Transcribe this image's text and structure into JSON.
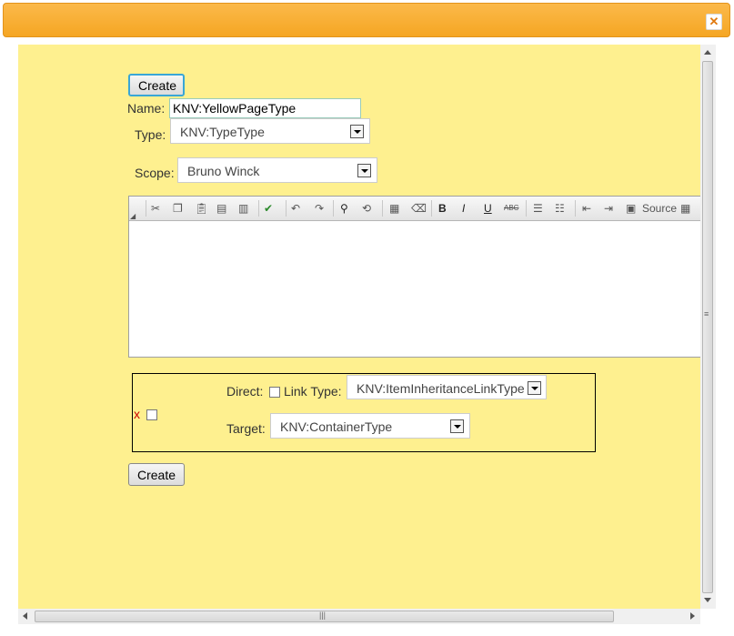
{
  "window": {
    "close_glyph": "✕"
  },
  "form": {
    "create_top_label": "Create",
    "name_label": "Name:",
    "name_value": "KNV:YellowPageType",
    "type_label": "Type:",
    "type_value": "KNV:TypeType",
    "scope_label": "Scope:",
    "scope_value": "Bruno Winck",
    "create_bottom_label": "Create"
  },
  "editor": {
    "toolbar": [
      "cut-icon",
      "copy-icon",
      "paste-icon",
      "paste-text-icon",
      "paste-word-icon",
      "spellcheck-icon",
      "undo-icon",
      "redo-icon",
      "find-icon",
      "replace-icon",
      "select-all-icon",
      "remove-format-icon",
      "bold-icon",
      "italic-icon",
      "underline-icon",
      "strike-icon",
      "numbered-list-icon",
      "bulleted-list-icon",
      "outdent-icon",
      "indent-icon",
      "source-icon",
      "table-icon"
    ],
    "bold": "B",
    "italic": "I",
    "underline": "U",
    "strike": "ABC",
    "source_label": "Source",
    "content": ""
  },
  "link": {
    "remove_glyph": "x",
    "direct_label": "Direct:",
    "link_type_label": "Link Type:",
    "link_type_value": "KNV:ItemInheritanceLinkType",
    "target_label": "Target:",
    "target_value": "KNV:ContainerType"
  },
  "colors": {
    "panel": "#fef08f",
    "titlebar": "#f5a623",
    "focus": "#39a6d6"
  }
}
